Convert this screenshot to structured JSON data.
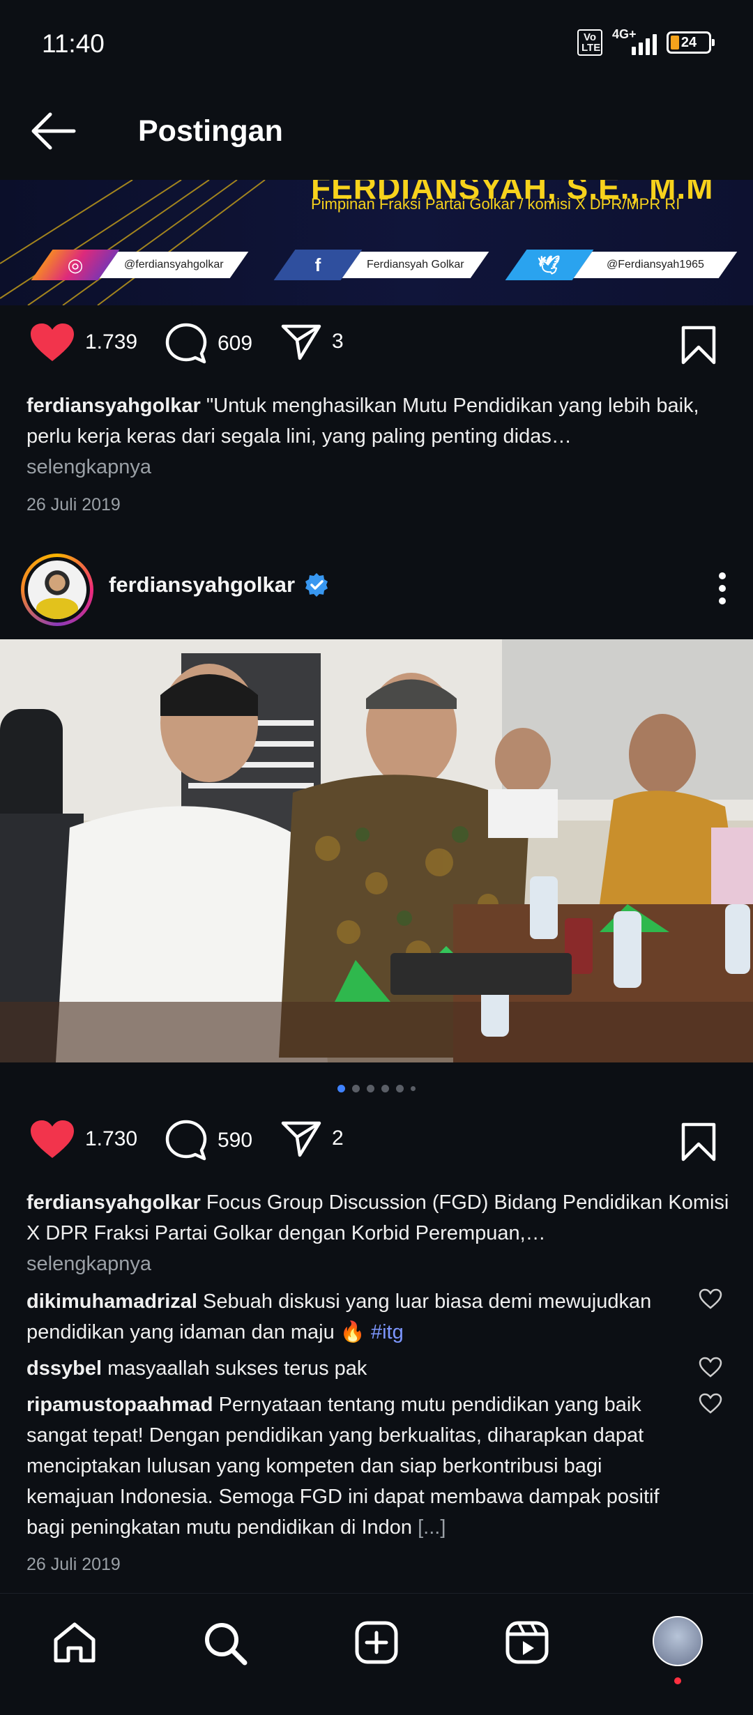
{
  "status_bar": {
    "time": "11:40",
    "volte": "Vo LTE",
    "network": "4G+",
    "battery": "24",
    "battery_level": 0.24
  },
  "header": {
    "title": "Postingan"
  },
  "banner": {
    "name": "FERDIANSYAH, S.E., M.M",
    "subtitle": "Pimpinan Fraksi Partai Golkar / komisi X DPR/MPR RI",
    "instagram": "@ferdiansyahgolkar",
    "facebook": "Ferdiansyah Golkar",
    "twitter": "@Ferdiansyah1965"
  },
  "post1": {
    "likes": "1.739",
    "comments": "609",
    "shares": "3",
    "username": "ferdiansyahgolkar",
    "caption": "\"Untuk menghasilkan Mutu Pendidikan yang lebih baik, perlu kerja keras dari segala lini, yang paling penting didas…",
    "more": "selengkapnya",
    "date": "26 Juli 2019"
  },
  "post2": {
    "username": "ferdiansyahgolkar",
    "likes": "1.730",
    "comments": "590",
    "shares": "2",
    "caption_user": "ferdiansyahgolkar",
    "caption": "Focus Group Discussion (FGD) Bidang Pendidikan Komisi X DPR Fraksi Partai Golkar dengan Korbid Perempuan,…",
    "more": "selengkapnya",
    "carousel_total": 6,
    "carousel_active": 1,
    "comments_list": [
      {
        "user": "dikimuhamadrizal",
        "text": "Sebuah diskusi yang luar biasa demi mewujudkan pendidikan yang idaman dan maju 🔥",
        "hashtag": "#itg"
      },
      {
        "user": "dssybel",
        "text": "masyaallah sukses terus pak",
        "hashtag": ""
      },
      {
        "user": "ripamustopaahmad",
        "text": "Pernyataan tentang mutu pendidikan yang baik sangat tepat! Dengan pendidikan yang berkualitas, diharapkan dapat menciptakan lulusan yang kompeten dan siap berkontribusi bagi kemajuan Indonesia. Semoga FGD ini dapat membawa dampak positif bagi peningkatan mutu pendidikan di Indon",
        "hashtag": "[...]"
      }
    ],
    "date": "26 Juli 2019"
  },
  "nav": {
    "items": [
      "home-icon",
      "search-icon",
      "create-icon",
      "reels-icon",
      "profile-avatar"
    ]
  },
  "colors": {
    "background": "#0c0f14",
    "like_red": "#f2344c",
    "verified_blue": "#3897f0",
    "hashtag": "#7d97ff",
    "banner_gold": "#f7d21c"
  }
}
